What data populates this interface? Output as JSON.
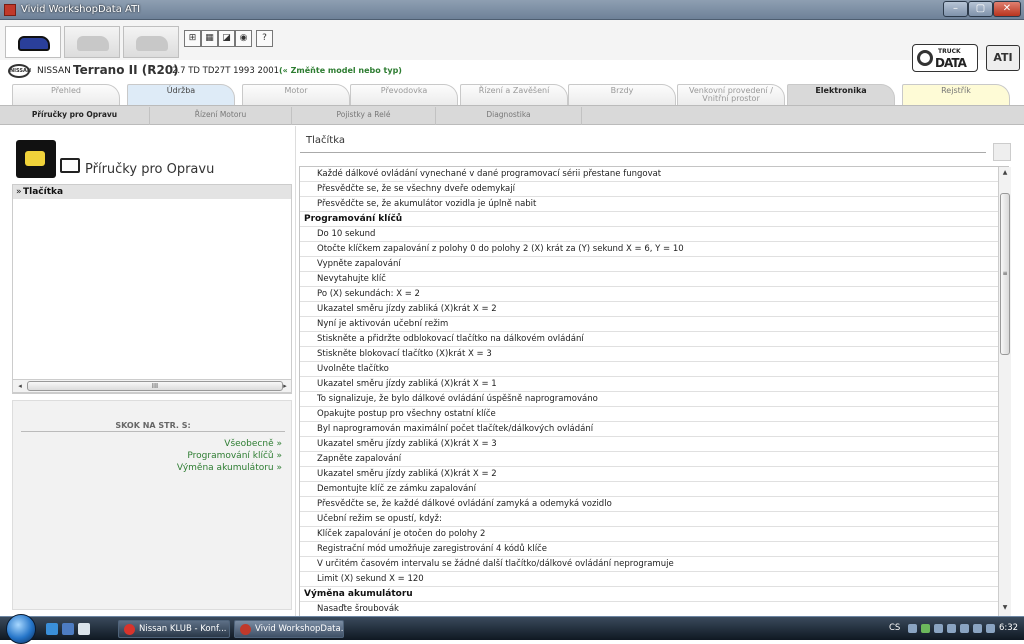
{
  "window": {
    "title": "Vivid WorkshopData ATI",
    "min": "–",
    "max": "▢",
    "close": "✕"
  },
  "toolbar": {
    "small_buttons": [
      "⊞",
      "▦",
      "◪",
      "◉",
      "?"
    ],
    "logo_small": "TRUCK",
    "logo_main": "DATA",
    "logo_ati": "ATI"
  },
  "vehicle": {
    "make_logo": "NISSAN",
    "make": "NISSAN",
    "model": "Terrano II (R20)",
    "spec": "2.7 TD TD27T 1993 2001",
    "change_link": "(« Změňte model nebo typ)"
  },
  "main_tabs": [
    {
      "line1": "Přehled",
      "line2": ""
    },
    {
      "line1": "Údržba",
      "line2": ""
    },
    {
      "line1": "Motor",
      "line2": ""
    },
    {
      "line1": "Převodovka",
      "line2": ""
    },
    {
      "line1": "Řízení a Zavěšení",
      "line2": ""
    },
    {
      "line1": "Brzdy",
      "line2": ""
    },
    {
      "line1": "Venkovní provedení /",
      "line2": "Vnitřní prostor"
    },
    {
      "line1": "Elektronika",
      "line2": ""
    },
    {
      "line1": "Rejstřík",
      "line2": ""
    }
  ],
  "sub_tabs": [
    "Příručky pro Opravu",
    "Řízení Motoru",
    "Pojistky a Relé",
    "Diagnostika"
  ],
  "left": {
    "title": "Příručky pro Opravu",
    "tree_item": "Tlačítka",
    "hscroll_left": "◂",
    "hscroll_grip": "III",
    "hscroll_right": "▸",
    "jump_title": "SKOK NA STR. S:",
    "jump_links": [
      "Všeobecně »",
      "Programování klíčů »",
      "Výměna akumulátoru »"
    ]
  },
  "right": {
    "title": "Tlačítka",
    "vscroll_up": "▲",
    "vscroll_grip": "≡",
    "vscroll_down": "▼",
    "rows": [
      {
        "type": "item",
        "text": "Každé dálkové ovládání vynechané v dané programovací sérii přestane fungovat"
      },
      {
        "type": "item",
        "text": "Přesvědčte se, že se všechny dveře odemykají"
      },
      {
        "type": "item",
        "text": "Přesvědčte se, že akumulátor vozidla je úplně nabit"
      },
      {
        "type": "header",
        "text": "Programování klíčů"
      },
      {
        "type": "item",
        "text": "Do 10 sekund"
      },
      {
        "type": "item",
        "text": "Otočte klíčkem zapalování z polohy 0 do polohy 2 (X) krát za (Y) sekund X = 6, Y = 10"
      },
      {
        "type": "item",
        "text": "Vypněte zapalování"
      },
      {
        "type": "item",
        "text": "Nevytahujte klíč"
      },
      {
        "type": "item",
        "text": "Po (X) sekundách: X = 2"
      },
      {
        "type": "item",
        "text": "Ukazatel směru jízdy zabliká (X)krát X = 2"
      },
      {
        "type": "item",
        "text": "Nyní je aktivován učební režim"
      },
      {
        "type": "item",
        "text": "Stiskněte a přidržte odblokovací tlačítko na dálkovém ovládání"
      },
      {
        "type": "item",
        "text": "Stiskněte blokovací tlačítko (X)krát  X = 3"
      },
      {
        "type": "item",
        "text": "Uvolněte tlačítko"
      },
      {
        "type": "item",
        "text": "Ukazatel směru jízdy zabliká (X)krát X = 1"
      },
      {
        "type": "item",
        "text": "To signalizuje, že bylo dálkové ovládání úspěšně naprogramováno"
      },
      {
        "type": "item",
        "text": "Opakujte postup pro všechny ostatní klíče"
      },
      {
        "type": "item",
        "text": "Byl naprogramován maximální počet tlačítek/dálkových ovládání"
      },
      {
        "type": "item",
        "text": "Ukazatel směru jízdy zabliká (X)krát X = 3"
      },
      {
        "type": "item",
        "text": "Zapněte zapalování"
      },
      {
        "type": "item",
        "text": "Ukazatel směru jízdy zabliká (X)krát X = 2"
      },
      {
        "type": "item",
        "text": "Demontujte klíč ze zámku zapalování"
      },
      {
        "type": "item",
        "text": "Přesvědčte se, že každé dálkové ovládání zamyká a odemyká vozidlo"
      },
      {
        "type": "item",
        "text": "Učební režim se opustí, když:"
      },
      {
        "type": "item",
        "text": "Klíček zapalování je otočen do polohy 2"
      },
      {
        "type": "item",
        "text": "Registrační mód umožňuje zaregistrování 4 kódů klíče"
      },
      {
        "type": "item",
        "text": "V určitém časovém intervalu se žádné další tlačítko/dálkové ovládání neprogramuje"
      },
      {
        "type": "item",
        "text": "Limit (X) sekund X = 120"
      },
      {
        "type": "header",
        "text": "Výměna akumulátoru"
      },
      {
        "type": "item",
        "text": "Nasaďte šroubovák"
      }
    ]
  },
  "taskbar": {
    "tasks": [
      "Nissan KLUB - Konf...",
      "Vivid WorkshopData..."
    ],
    "lang": "CS",
    "clock": "6:32"
  },
  "colors": {
    "accent_green": "#2e7d32",
    "tab_active": "#d9d9d9",
    "tab_blue": "#deebf7",
    "tab_yellow": "#fefbd6"
  }
}
